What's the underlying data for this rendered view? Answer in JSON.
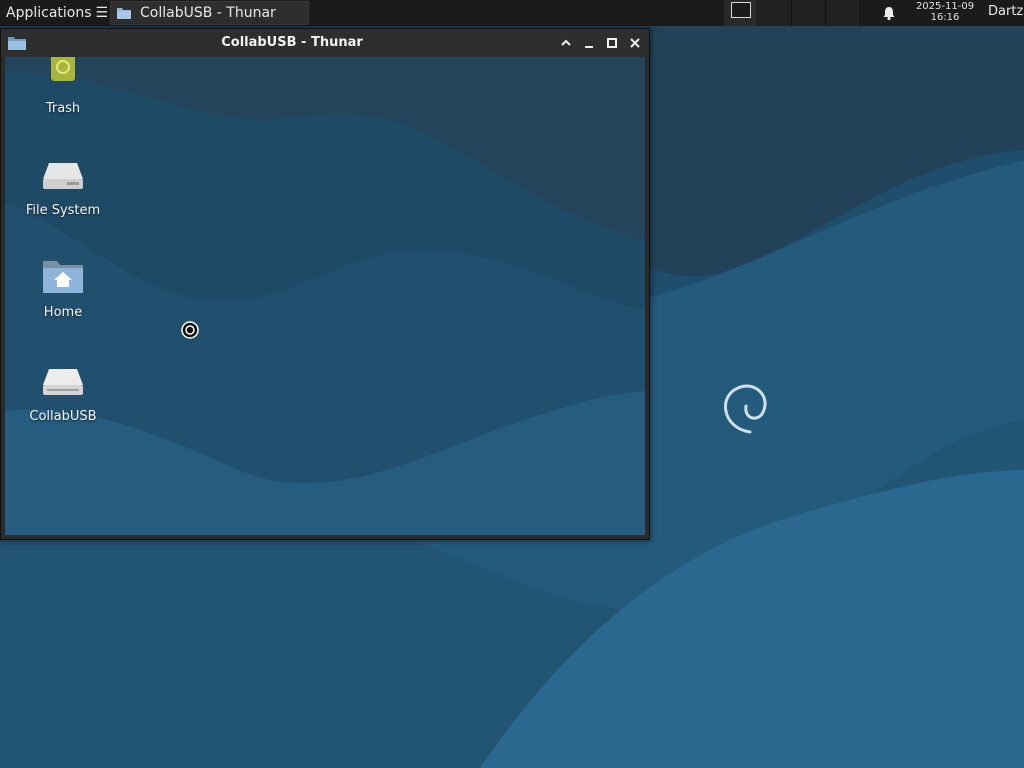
{
  "panel": {
    "apps_label": "Applications",
    "apps_suffix": "☰",
    "task_label": "CollabUSB - Thunar",
    "clock_date": "2025-11-09",
    "clock_time": "16:16",
    "user": "Dartz"
  },
  "window": {
    "title": "CollabUSB - Thunar",
    "items": [
      {
        "label": "Trash",
        "icon": "trash-icon"
      },
      {
        "label": "File System",
        "icon": "drive-icon"
      },
      {
        "label": "Home",
        "icon": "home-folder-icon"
      },
      {
        "label": "CollabUSB",
        "icon": "usb-drive-icon"
      }
    ]
  },
  "colors": {
    "panel_bg": "#1b1b1b",
    "wallpaper_dark": "#1b3f58",
    "wallpaper_mid": "#22577a",
    "wallpaper_light": "#2a6a92"
  }
}
